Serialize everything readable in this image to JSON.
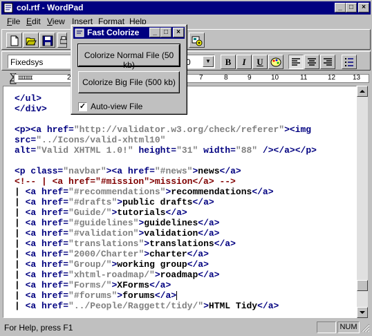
{
  "window": {
    "title": "col.rtf - WordPad",
    "minimize": "_",
    "maximize": "□",
    "close": "×"
  },
  "menu": [
    {
      "label": "File",
      "key": "F"
    },
    {
      "label": "Edit",
      "key": "E"
    },
    {
      "label": "View",
      "key": "V"
    },
    {
      "label": "Insert",
      "key": "I"
    },
    {
      "label": "Format",
      "key": "o"
    },
    {
      "label": "Help",
      "key": "H"
    }
  ],
  "toolbar": {
    "icons": [
      "new-icon",
      "open-icon",
      "save-icon",
      "print-icon"
    ],
    "right_icon": "insert-object-icon"
  },
  "format_bar": {
    "font": "Fixedsys",
    "size": "0",
    "bold": "B",
    "italic": "I",
    "underline": "U"
  },
  "ruler": {
    "left_marker": "ɪɪɪɪɪɪɪɪ",
    "numbers": [
      "2",
      "7",
      "8",
      "9",
      "10",
      "11",
      "12",
      "13"
    ]
  },
  "document": {
    "lines": [
      [
        [
          "tag",
          "</ul>"
        ]
      ],
      [
        [
          "tag",
          "</div>"
        ]
      ],
      [],
      [
        [
          "tag",
          "<p><a "
        ],
        [
          "attr",
          "href="
        ],
        [
          "str",
          "\"http://validator.w3.org/check/referer\""
        ],
        [
          "tag",
          "><img"
        ]
      ],
      [
        [
          "attr",
          "src="
        ],
        [
          "str",
          "\"../Icons/valid-xhtml10\""
        ]
      ],
      [
        [
          "attr",
          "alt="
        ],
        [
          "str",
          "\"Valid XHTML 1.0!\""
        ],
        [
          "attr",
          " height="
        ],
        [
          "str",
          "\"31\""
        ],
        [
          "attr",
          " width="
        ],
        [
          "str",
          "\"88\""
        ],
        [
          "tag",
          " /></a></p>"
        ]
      ],
      [],
      [
        [
          "tag",
          "<p "
        ],
        [
          "attr",
          "class="
        ],
        [
          "str",
          "\"navbar\""
        ],
        [
          "tag",
          "><a "
        ],
        [
          "attr",
          "href="
        ],
        [
          "str",
          "\"#news\""
        ],
        [
          "tag",
          ">"
        ],
        [
          "txt",
          "news"
        ],
        [
          "tag",
          "</a>"
        ]
      ],
      [
        [
          "cmt",
          "<!-- | <a href=\"#mission\">mission</a> -->"
        ]
      ],
      [
        [
          "txt",
          "| "
        ],
        [
          "tag",
          "<a "
        ],
        [
          "attr",
          "href="
        ],
        [
          "str",
          "\"#recommendations\""
        ],
        [
          "tag",
          ">"
        ],
        [
          "txt",
          "recommendations"
        ],
        [
          "tag",
          "</a>"
        ]
      ],
      [
        [
          "txt",
          "| "
        ],
        [
          "tag",
          "<a "
        ],
        [
          "attr",
          "href="
        ],
        [
          "str",
          "\"#drafts\""
        ],
        [
          "tag",
          ">"
        ],
        [
          "txt",
          "public drafts"
        ],
        [
          "tag",
          "</a>"
        ]
      ],
      [
        [
          "txt",
          "| "
        ],
        [
          "tag",
          "<a "
        ],
        [
          "attr",
          "href="
        ],
        [
          "str",
          "\"Guide/\""
        ],
        [
          "tag",
          ">"
        ],
        [
          "txt",
          "tutorials"
        ],
        [
          "tag",
          "</a>"
        ]
      ],
      [
        [
          "txt",
          "| "
        ],
        [
          "tag",
          "<a "
        ],
        [
          "attr",
          "href="
        ],
        [
          "str",
          "\"#guidelines\""
        ],
        [
          "tag",
          ">"
        ],
        [
          "txt",
          "guidelines"
        ],
        [
          "tag",
          "</a>"
        ]
      ],
      [
        [
          "txt",
          "| "
        ],
        [
          "tag",
          "<a "
        ],
        [
          "attr",
          "href="
        ],
        [
          "str",
          "\"#validation\""
        ],
        [
          "tag",
          ">"
        ],
        [
          "txt",
          "validation"
        ],
        [
          "tag",
          "</a>"
        ]
      ],
      [
        [
          "txt",
          "| "
        ],
        [
          "tag",
          "<a "
        ],
        [
          "attr",
          "href="
        ],
        [
          "str",
          "\"translations\""
        ],
        [
          "tag",
          ">"
        ],
        [
          "txt",
          "translations"
        ],
        [
          "tag",
          "</a>"
        ]
      ],
      [
        [
          "txt",
          "| "
        ],
        [
          "tag",
          "<a "
        ],
        [
          "attr",
          "href="
        ],
        [
          "str",
          "\"2000/Charter\""
        ],
        [
          "tag",
          ">"
        ],
        [
          "txt",
          "charter"
        ],
        [
          "tag",
          "</a>"
        ]
      ],
      [
        [
          "txt",
          "| "
        ],
        [
          "tag",
          "<a "
        ],
        [
          "attr",
          "href="
        ],
        [
          "str",
          "\"Group/\""
        ],
        [
          "tag",
          ">"
        ],
        [
          "txt",
          "working group"
        ],
        [
          "tag",
          "</a>"
        ]
      ],
      [
        [
          "txt",
          "| "
        ],
        [
          "tag",
          "<a "
        ],
        [
          "attr",
          "href="
        ],
        [
          "str",
          "\"xhtml-roadmap/\""
        ],
        [
          "tag",
          ">"
        ],
        [
          "txt",
          "roadmap"
        ],
        [
          "tag",
          "</a>"
        ]
      ],
      [
        [
          "txt",
          "| "
        ],
        [
          "tag",
          "<a "
        ],
        [
          "attr",
          "href="
        ],
        [
          "str",
          "\"Forms/\""
        ],
        [
          "tag",
          ">"
        ],
        [
          "txt",
          "XForms"
        ],
        [
          "tag",
          "</a>"
        ]
      ],
      [
        [
          "txt",
          "| "
        ],
        [
          "tag",
          "<a "
        ],
        [
          "attr",
          "href="
        ],
        [
          "str",
          "\"#forums\""
        ],
        [
          "tag",
          ">"
        ],
        [
          "txt",
          "forums"
        ],
        [
          "tag",
          "</a>"
        ],
        [
          "caret",
          ""
        ]
      ],
      [
        [
          "txt",
          "| "
        ],
        [
          "tag",
          "<a "
        ],
        [
          "attr",
          "href="
        ],
        [
          "str",
          "\"../People/Raggett/tidy/\""
        ],
        [
          "tag",
          ">"
        ],
        [
          "txt",
          "HTML Tidy"
        ],
        [
          "tag",
          "</a>"
        ]
      ]
    ]
  },
  "statusbar": {
    "help": "For Help, press F1",
    "num": "NUM"
  },
  "dialog": {
    "title": "Fast Colorize",
    "btn_normal": "Colorize Normal File (50 kb)",
    "btn_big": "Colorize Big File (500 kb)",
    "checkbox_label": "Auto-view File",
    "checkbox_checked": "✓"
  }
}
